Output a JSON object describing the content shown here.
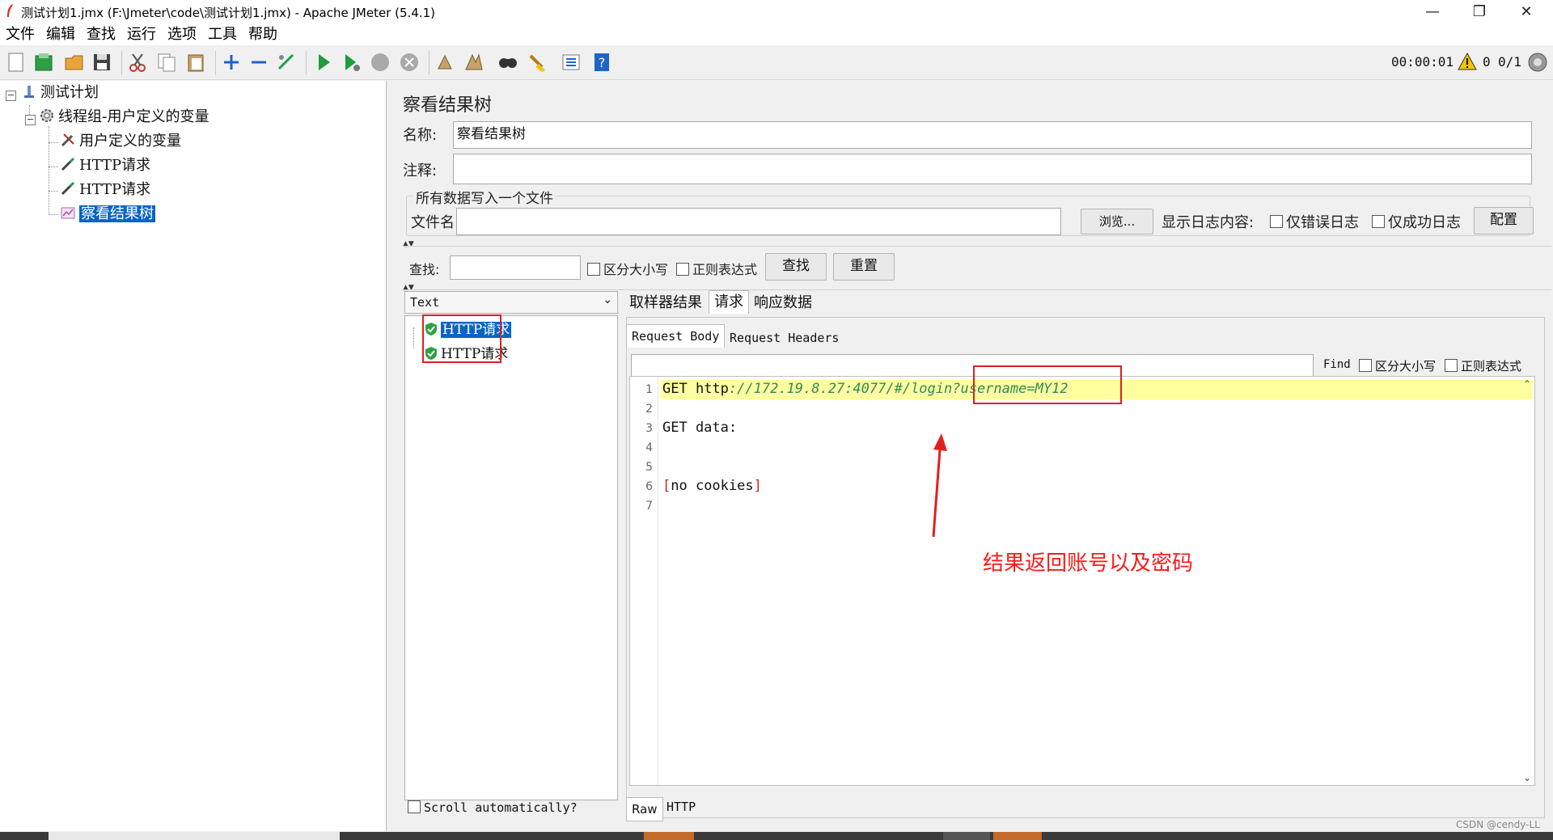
{
  "window": {
    "title": "测试计划1.jmx (F:\\Jmeter\\code\\测试计划1.jmx) - Apache JMeter (5.4.1)",
    "minimize": "—",
    "restore": "❐",
    "close": "✕"
  },
  "menu": [
    "文件",
    "编辑",
    "查找",
    "运行",
    "选项",
    "工具",
    "帮助"
  ],
  "toolbar": {
    "timer": "00:00:01",
    "warning_count": "0",
    "threads": "0/1"
  },
  "tree": {
    "root": "测试计划",
    "thread_group": "线程组-用户定义的变量",
    "user_vars": "用户定义的变量",
    "http1": "HTTP请求",
    "http2": "HTTP请求",
    "listener": "察看结果树"
  },
  "panel": {
    "title": "察看结果树",
    "name_label": "名称:",
    "name_value": "察看结果树",
    "comment_label": "注释:",
    "comment_value": "",
    "file_section": "所有数据写入一个文件",
    "file_label": "文件名",
    "file_value": "",
    "browse": "浏览...",
    "log_display": "显示日志内容:",
    "errors_only": "仅错误日志",
    "success_only": "仅成功日志",
    "configure": "配置"
  },
  "search": {
    "label": "查找:",
    "value": "",
    "case": "区分大小写",
    "regex": "正则表达式",
    "find_btn": "查找",
    "reset_btn": "重置"
  },
  "results": {
    "renderer": "Text",
    "items": [
      "HTTP请求",
      "HTTP请求"
    ],
    "scroll_auto": "Scroll automatically?"
  },
  "detail_tabs": [
    "取样器结果",
    "请求",
    "响应数据"
  ],
  "request_tabs": [
    "Request Body",
    "Request Headers"
  ],
  "find_bar": {
    "value": "",
    "find": "Find",
    "case": "区分大小写",
    "regex": "正则表达式"
  },
  "editor": {
    "line_numbers": [
      "1",
      "2",
      "3",
      "4",
      "5",
      "6",
      "7"
    ],
    "line1_method": "GET ",
    "line1_scheme": "http",
    "line1_url": "://172.19.8.27:4077/#/login?username=MY12",
    "line3": "GET data:",
    "line6_open": "[",
    "line6_text": "no cookies",
    "line6_close": "]"
  },
  "bottom_tabs": [
    "Raw",
    "HTTP"
  ],
  "annotation": "结果返回账号以及密码",
  "watermark": "CSDN @cendy-LL",
  "colors": {
    "selection": "#0a64c8",
    "highlight_line": "#ffffa0",
    "annotation": "#ff1a1a",
    "url_green": "#2e8b57",
    "bracket_red": "#d02020"
  }
}
